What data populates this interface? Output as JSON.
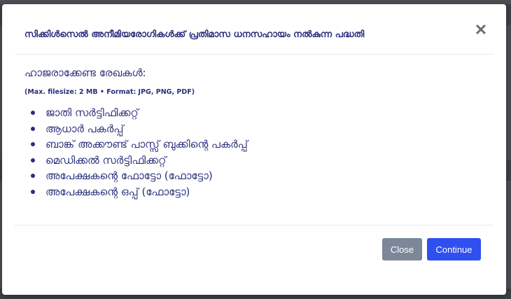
{
  "modal": {
    "title": "സിക്കിൾസെൽ അനീമിയരോഗികൾക്ക് പ്രതിമാസ ധനസഹായം നൽകുന്ന പദ്ധതി",
    "close_icon": "close-icon"
  },
  "body": {
    "heading": "ഹാജരാക്കേണ്ട രേഖകൾ:",
    "file_note": "(Max. filesize: 2 MB • Format: JPG, PNG, PDF)",
    "documents": [
      "ജാതി സർട്ടിഫിക്കറ്റ്",
      "ആധാർ പകർപ്പ്",
      "ബാങ്ക് അക്കൗണ്ട് പാസ്സ് ബുക്കിന്റെ പകർപ്പ്",
      "മെഡിക്കൽ സർട്ടിഫിക്കറ്റ്",
      "അപേക്ഷകന്റെ ഫോട്ടോ (ഫോട്ടോ)",
      "അപേക്ഷകന്റെ ഒപ്പ് (ഫോട്ടോ)"
    ]
  },
  "footer": {
    "close_label": "Close",
    "continue_label": "Continue"
  },
  "colors": {
    "accent": "#2f4ff0",
    "secondary_button": "#7d8799",
    "text": "#2b2f7a"
  }
}
